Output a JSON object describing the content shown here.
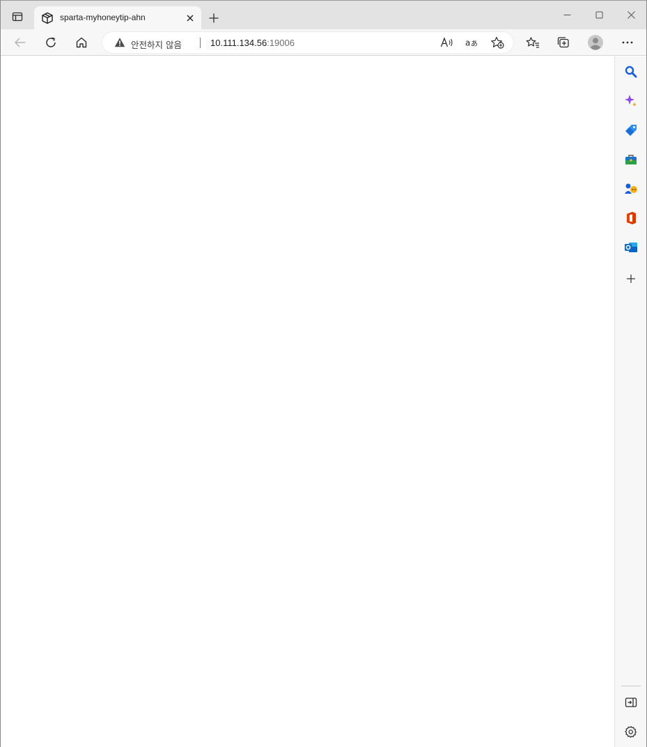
{
  "tab": {
    "title": "sparta-myhoneytip-ahn"
  },
  "address_bar": {
    "security_label": "안전하지 않음",
    "host": "10.111.134.56",
    "port": ":19006"
  },
  "icons": {
    "tab_actions": "tab-actions-icon",
    "favicon": "codesandbox-cube-icon",
    "tab_close": "close-icon",
    "new_tab": "plus-icon",
    "minimize": "minimize-icon",
    "maximize": "maximize-icon",
    "close_window": "close-icon",
    "back": "arrow-left-icon",
    "refresh": "refresh-icon",
    "home": "home-icon",
    "not_secure": "warning-triangle-icon",
    "read_aloud": "read-aloud-icon",
    "translate": "translate-icon",
    "add_favorite": "star-add-icon",
    "favorites": "favorites-icon",
    "collections": "collections-icon",
    "profile": "profile-avatar-icon",
    "more": "more-ellipsis-icon",
    "sidebar": [
      "search-icon",
      "copilot-sparkle-icon",
      "shopping-tag-icon",
      "tools-briefcase-icon",
      "games-icon",
      "office-icon",
      "outlook-icon",
      "plus-icon",
      "hide-sidebar-icon",
      "settings-gear-icon"
    ]
  },
  "colors": {
    "tabstrip_bg": "#e3e3e3",
    "toolbar_bg": "#f7f7f7",
    "search_blue": "#1a5fd6",
    "copilot_purple": "#8a4be6",
    "office_red": "#d83b01",
    "outlook_blue": "#0f6cbd"
  }
}
